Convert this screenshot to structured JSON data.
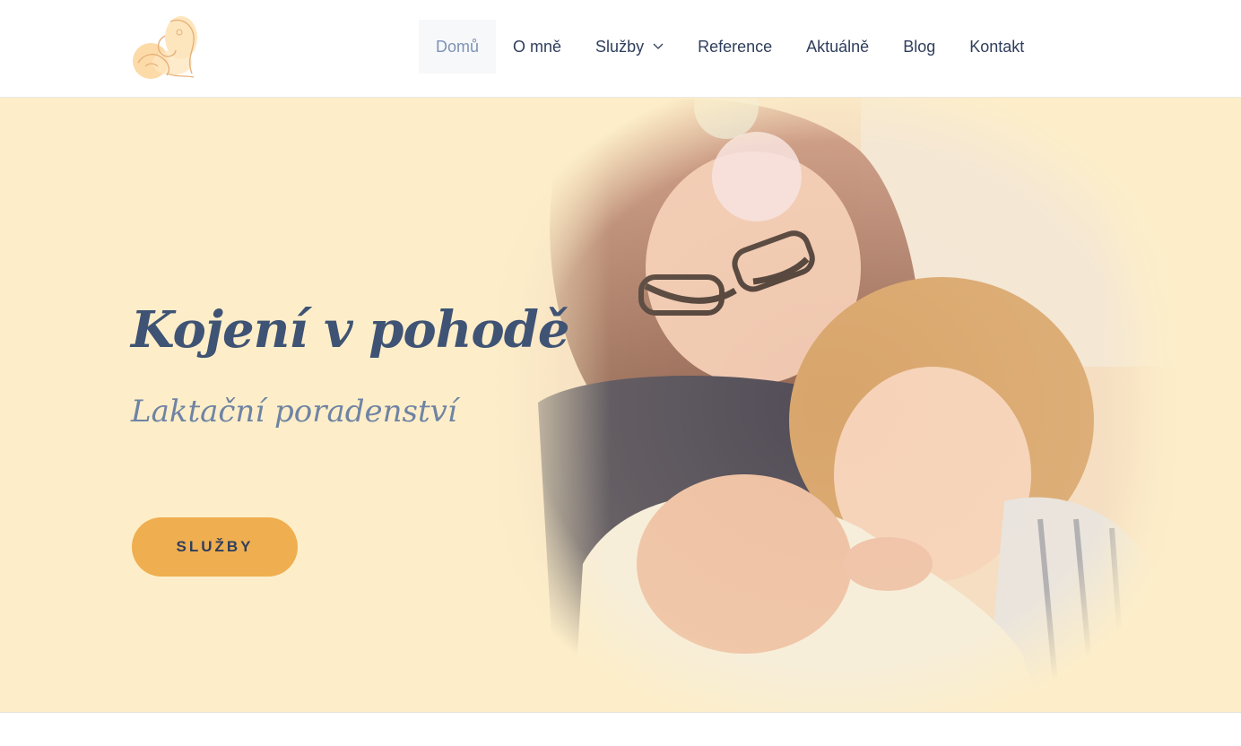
{
  "nav": {
    "items": [
      {
        "label": "Domů",
        "active": true
      },
      {
        "label": "O mně"
      },
      {
        "label": "Služby",
        "has_dropdown": true
      },
      {
        "label": "Reference"
      },
      {
        "label": "Aktuálně"
      },
      {
        "label": "Blog"
      },
      {
        "label": "Kontakt"
      }
    ]
  },
  "hero": {
    "title": "Kojení v pohodě",
    "subtitle": "Laktační poradenství",
    "button_label": "SLUŽBY"
  },
  "icons": {
    "logo": "mother-nursing-baby-logo",
    "dropdown": "chevron-down-icon"
  },
  "colors": {
    "hero_background": "#fdeec9",
    "heading": "#3f5374",
    "subtitle": "#6f83a3",
    "button": "#efae4f",
    "nav_text": "#2f3e5c",
    "nav_active": "#7d93b5"
  }
}
